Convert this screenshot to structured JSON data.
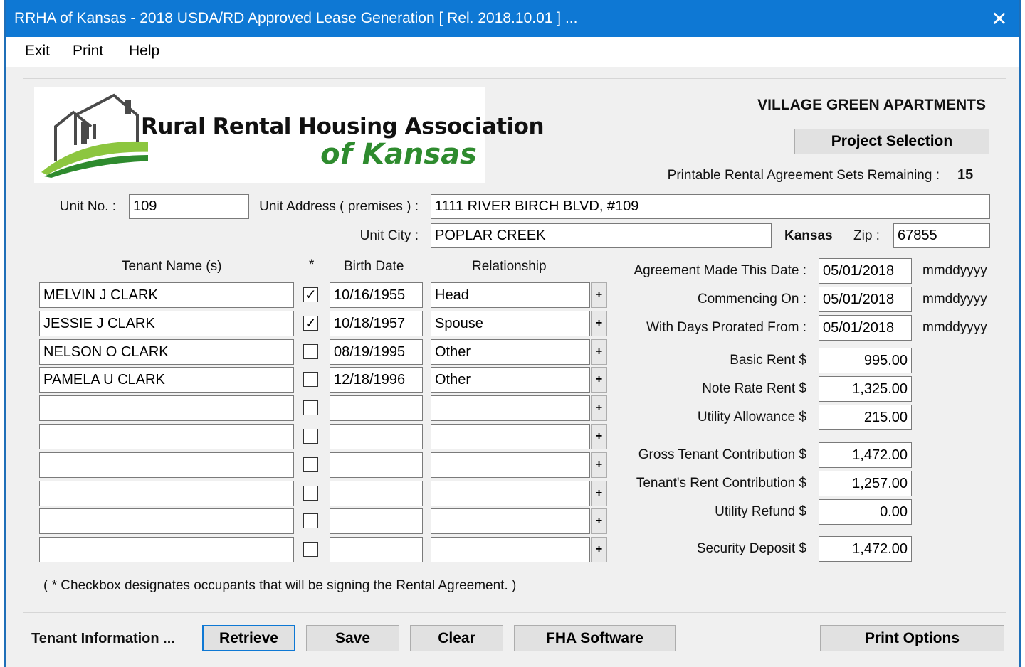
{
  "window": {
    "title": "RRHA of Kansas - 2018 USDA/RD Approved Lease Generation [ Rel. 2018.10.01 ] ..."
  },
  "menu": [
    "Exit",
    "Print",
    "Help"
  ],
  "logo": {
    "line1": "Rural Rental Housing Association",
    "line2": "of Kansas"
  },
  "project": {
    "name": "VILLAGE GREEN APARTMENTS",
    "selection_button": "Project Selection",
    "remaining_label": "Printable Rental Agreement Sets Remaining :",
    "remaining_value": "15"
  },
  "unit": {
    "no_label": "Unit No. :",
    "no_value": "109",
    "address_label": "Unit Address ( premises ) :",
    "address_value": "1111 RIVER BIRCH BLVD, #109",
    "city_label": "Unit City :",
    "city_value": "POPLAR CREEK",
    "state": "Kansas",
    "zip_label": "Zip :",
    "zip_value": "67855"
  },
  "tenants": {
    "headers": {
      "name": "Tenant Name (s)",
      "sign": "*",
      "birth": "Birth Date",
      "relationship": "Relationship"
    },
    "rows": [
      {
        "name": "MELVIN J CLARK",
        "checked": true,
        "birth": "10/16/1955",
        "relationship": "Head"
      },
      {
        "name": "JESSIE J CLARK",
        "checked": true,
        "birth": "10/18/1957",
        "relationship": "Spouse"
      },
      {
        "name": "NELSON O CLARK",
        "checked": false,
        "birth": "08/19/1995",
        "relationship": "Other"
      },
      {
        "name": "PAMELA U CLARK",
        "checked": false,
        "birth": "12/18/1996",
        "relationship": "Other"
      },
      {
        "name": "",
        "checked": false,
        "birth": "",
        "relationship": ""
      },
      {
        "name": "",
        "checked": false,
        "birth": "",
        "relationship": ""
      },
      {
        "name": "",
        "checked": false,
        "birth": "",
        "relationship": ""
      },
      {
        "name": "",
        "checked": false,
        "birth": "",
        "relationship": ""
      },
      {
        "name": "",
        "checked": false,
        "birth": "",
        "relationship": ""
      },
      {
        "name": "",
        "checked": false,
        "birth": "",
        "relationship": ""
      }
    ],
    "plus_glyph": "+",
    "check_glyph": "✓",
    "footnote": "( * Checkbox designates occupants that will be signing the Rental Agreement. )"
  },
  "dates": [
    {
      "label": "Agreement Made This Date :",
      "value": "05/01/2018",
      "format": "mmddyyyy"
    },
    {
      "label": "Commencing On :",
      "value": "05/01/2018",
      "format": "mmddyyyy"
    },
    {
      "label": "With Days Prorated From :",
      "value": "05/01/2018",
      "format": "mmddyyyy"
    }
  ],
  "amounts": [
    {
      "label": "Basic Rent $",
      "value": "995.00"
    },
    {
      "label": "Note Rate Rent $",
      "value": "1,325.00"
    },
    {
      "label": "Utility Allowance $",
      "value": "215.00"
    },
    {
      "label": "Gross Tenant Contribution $",
      "value": "1,472.00"
    },
    {
      "label": "Tenant's Rent Contribution $",
      "value": "1,257.00"
    },
    {
      "label": "Utility Refund $",
      "value": "0.00"
    },
    {
      "label": "Security Deposit $",
      "value": "1,472.00"
    }
  ],
  "footer": {
    "label": "Tenant Information ...",
    "buttons": [
      "Retrieve",
      "Save",
      "Clear",
      "FHA Software",
      "Print Options"
    ]
  },
  "colors": {
    "titlebar": "#0e78d4",
    "logo_green": "#2e8b2e",
    "window_bg": "#f0f0f0"
  },
  "icons": {
    "close": "close-icon",
    "logo": "house-logo-icon"
  }
}
